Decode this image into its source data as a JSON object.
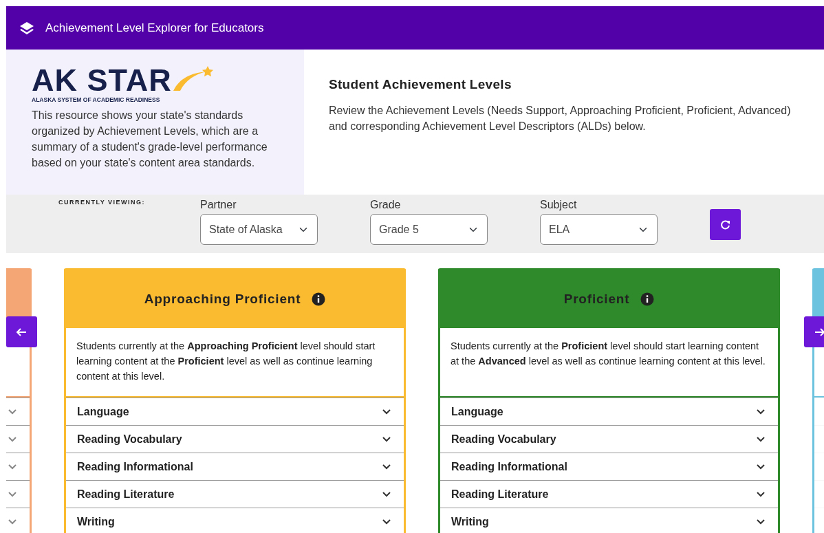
{
  "header": {
    "title": "Achievement Level Explorer for Educators"
  },
  "intro": {
    "logo_title": "AK STAR",
    "logo_subtitle": "ALASKA SYSTEM OF ACADEMIC READINESS",
    "text": "This resource shows your state's standards organized by Achievement Levels, which are a summary of a student's grade-level performance based on your state's content area standards."
  },
  "overview": {
    "title": "Student Achievement Levels",
    "text": "Review the Achievement Levels (Needs Support, Approaching Proficient, Proficient, Advanced) and corresponding Achievement Level Descriptors (ALDs) below."
  },
  "filters": {
    "label": "CURRENTLY VIEWING:",
    "selects": [
      {
        "label": "Partner",
        "value": "State of Alaska"
      },
      {
        "label": "Grade",
        "value": "Grade 5"
      },
      {
        "label": "Subject",
        "value": "ELA"
      }
    ]
  },
  "levels": [
    {
      "kind": "partial",
      "color": "#f4a774"
    },
    {
      "kind": "full",
      "color": "#fbbb30",
      "name": "Approaching Proficient",
      "description": "Students currently at the **Approaching Proficient** level should start learning content at the **Proficient** level as well as continue learning content at this level.",
      "categories": [
        "Language",
        "Reading Vocabulary",
        "Reading Informational",
        "Reading Literature",
        "Writing"
      ]
    },
    {
      "kind": "full",
      "color": "#2f8a2b",
      "name": "Proficient",
      "description": "Students currently at the **Proficient** level should start learning content at the **Advanced** level as well as continue learning content at this level.",
      "categories": [
        "Language",
        "Reading Vocabulary",
        "Reading Informational",
        "Reading Literature",
        "Writing"
      ]
    },
    {
      "kind": "faded",
      "color": "#6cc3e0"
    }
  ]
}
